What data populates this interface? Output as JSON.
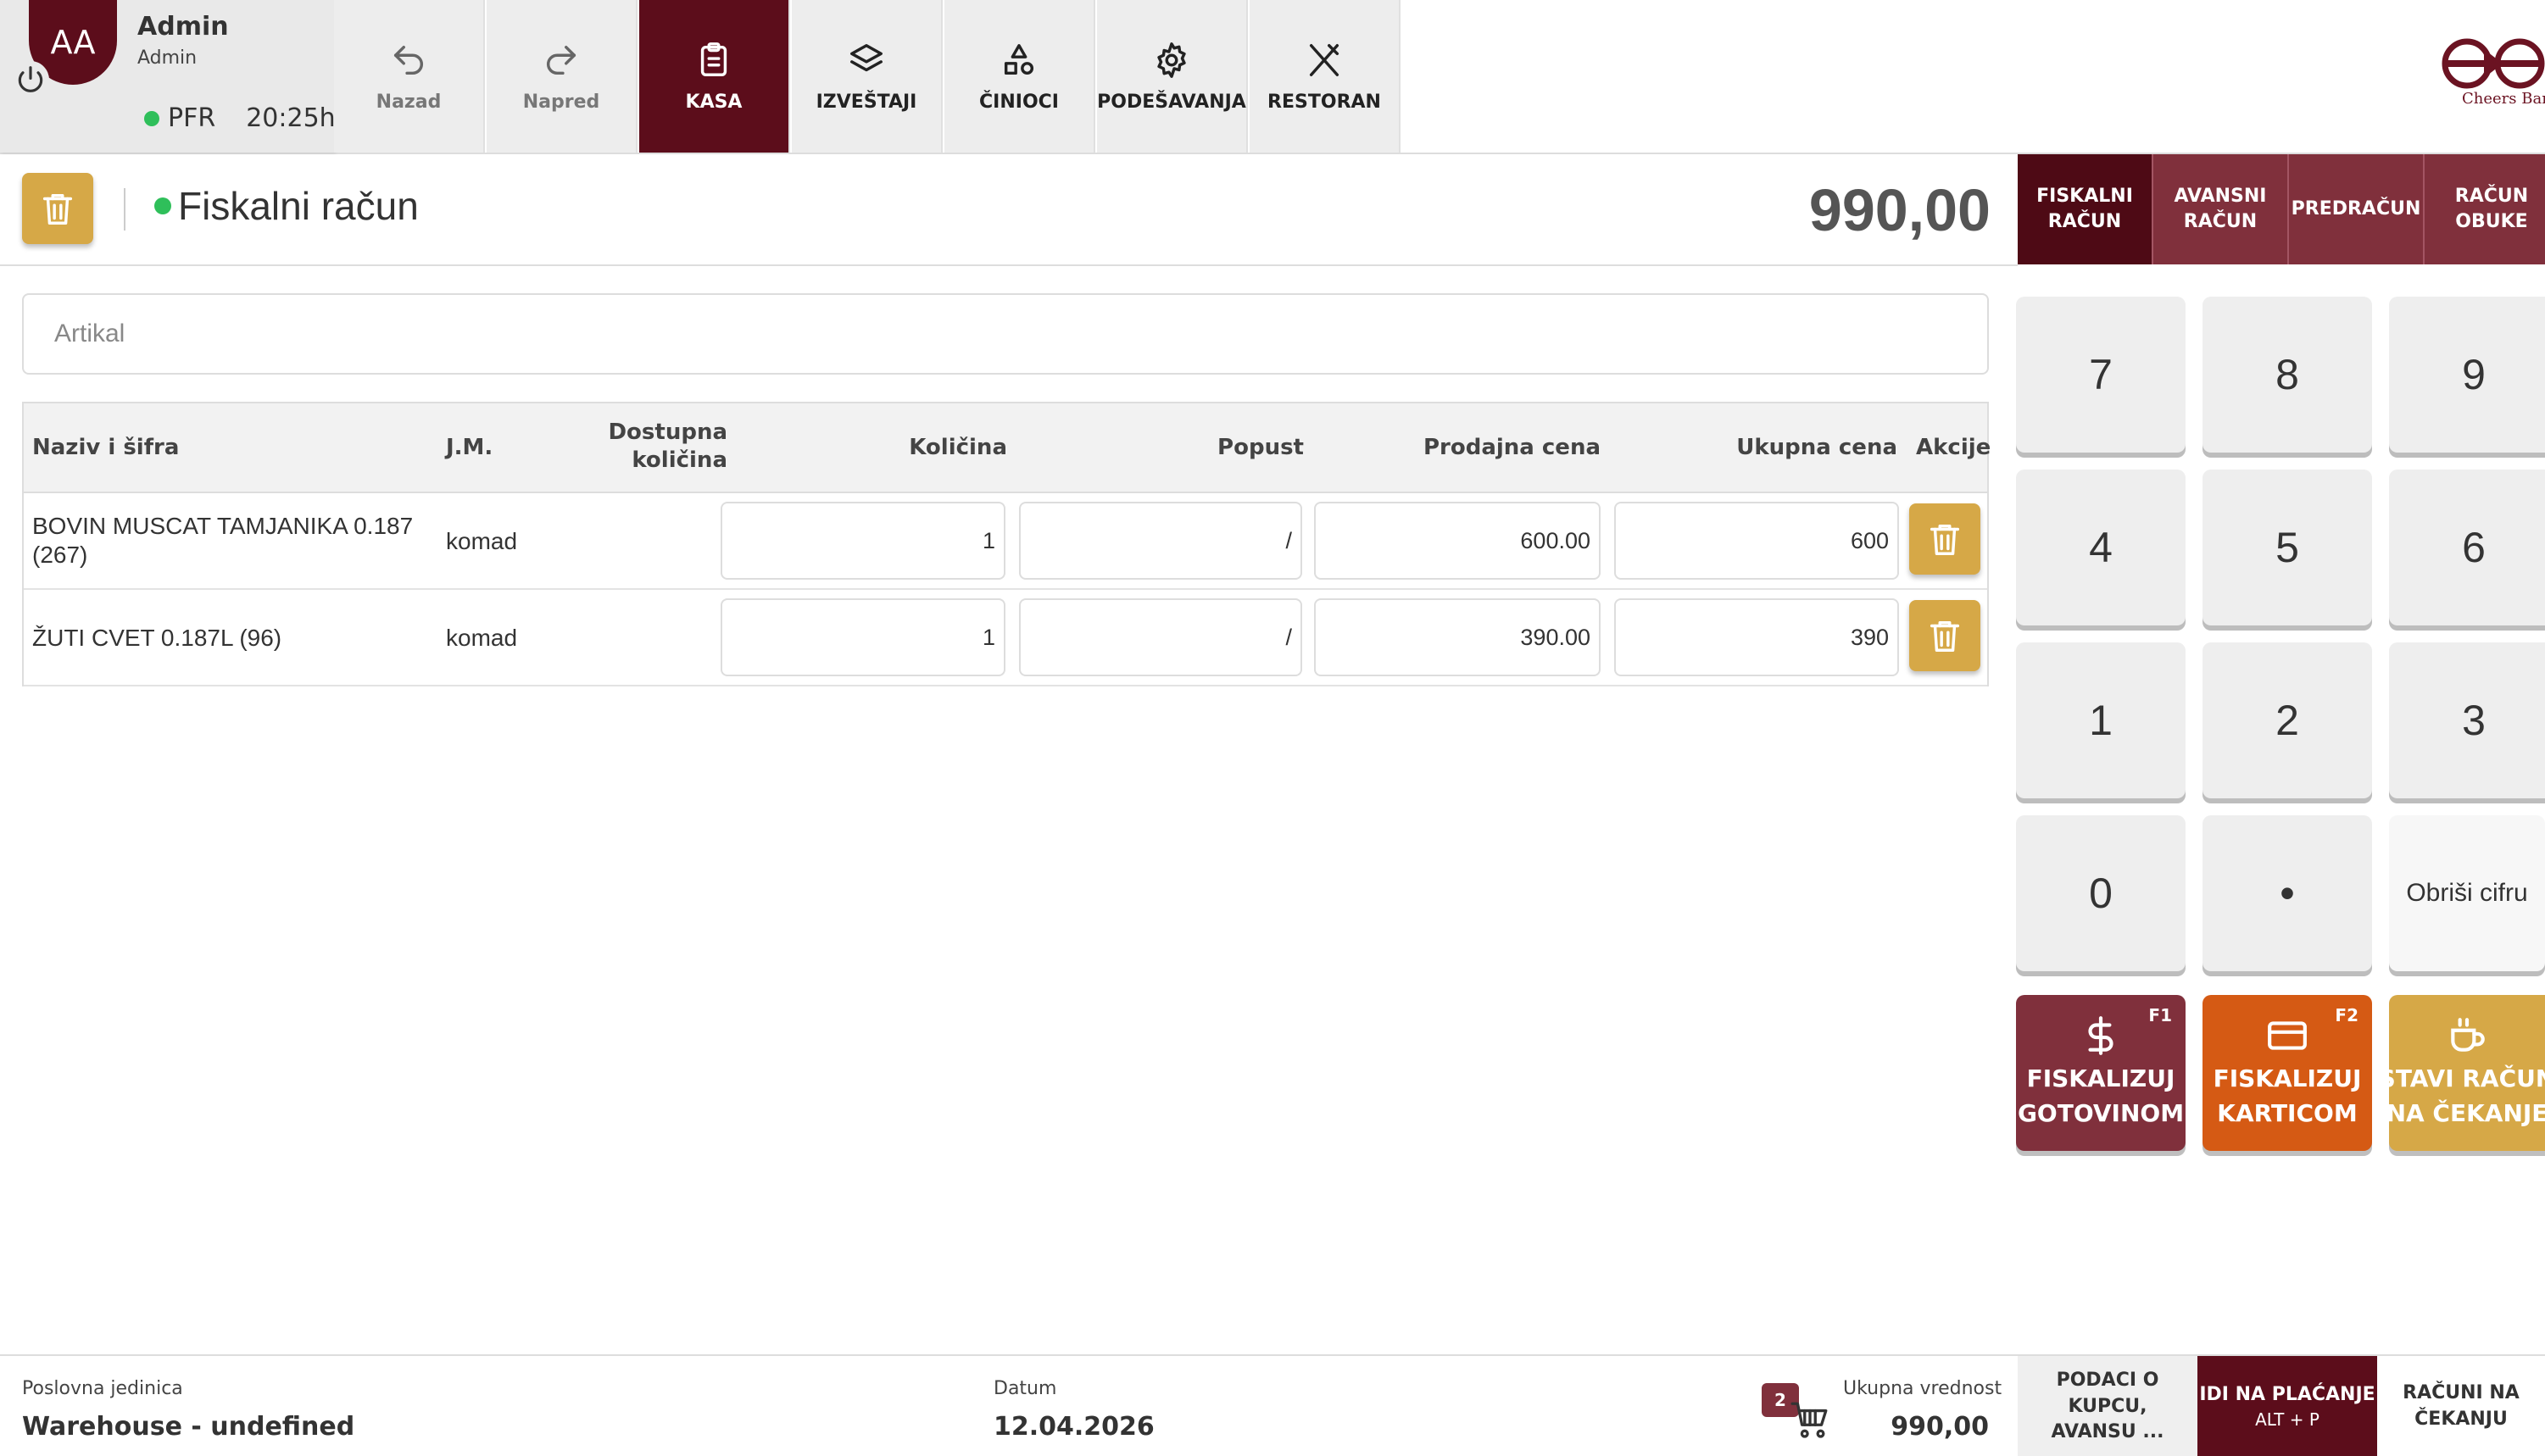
{
  "user": {
    "initials": "AA",
    "name": "Admin",
    "role": "Admin",
    "pfr_label": "PFR",
    "time": "20:25h"
  },
  "nav": [
    {
      "label": "Nazad",
      "icon": "undo-icon"
    },
    {
      "label": "Napred",
      "icon": "redo-icon"
    },
    {
      "label": "KASA",
      "icon": "clipboard-icon"
    },
    {
      "label": "IZVEŠTAJI",
      "icon": "layers-icon"
    },
    {
      "label": "ČINIOCI",
      "icon": "shapes-icon"
    },
    {
      "label": "PODEŠAVANJA",
      "icon": "gear-icon"
    },
    {
      "label": "RESTORAN",
      "icon": "utensils-icon"
    }
  ],
  "brand": {
    "name": "Cheers Bar",
    "color": "#6b1322"
  },
  "receipt": {
    "title": "Fiskalni račun",
    "total": "990,00"
  },
  "doc_tabs": [
    {
      "line1": "FISKALNI",
      "line2": "RAČUN"
    },
    {
      "line1": "AVANSNI",
      "line2": "RAČUN"
    },
    {
      "line1": "PREDRAČUN",
      "line2": ""
    },
    {
      "line1": "RAČUN",
      "line2": "OBUKE"
    }
  ],
  "search": {
    "placeholder": "Artikal",
    "value": ""
  },
  "table": {
    "headers": {
      "name": "Naziv i šifra",
      "unit": "J.M.",
      "available_1": "Dostupna",
      "available_2": "količina",
      "qty": "Količina",
      "discount": "Popust",
      "price": "Prodajna cena",
      "total": "Ukupna cena",
      "actions": "Akcije"
    },
    "rows": [
      {
        "name": "BOVIN MUSCAT TAMJANIKA 0.187 (267)",
        "unit": "komad",
        "available": "/",
        "qty": "1",
        "discount": "/",
        "price": "600.00",
        "total": "600"
      },
      {
        "name": "ŽUTI CVET 0.187L (96)",
        "unit": "komad",
        "available": "/",
        "qty": "1",
        "discount": "/",
        "price": "390.00",
        "total": "390"
      }
    ]
  },
  "keypad": {
    "keys": [
      "7",
      "8",
      "9",
      "4",
      "5",
      "6",
      "1",
      "2",
      "3",
      "0",
      "•",
      "Obriši cifru"
    ],
    "actions": [
      {
        "line1": "FISKALIZUJ",
        "line2": "GOTOVINOM",
        "fkey": "F1",
        "icon": "dollar-icon",
        "color": "#80303c"
      },
      {
        "line1": "FISKALIZUJ",
        "line2": "KARTICOM",
        "fkey": "F2",
        "icon": "credit-card-icon",
        "color": "#d55a14"
      },
      {
        "line1": "STAVI RAČUN",
        "line2": "NA ČEKANJE",
        "fkey": "",
        "icon": "coffee-cup-icon",
        "color": "#d6a847"
      }
    ]
  },
  "footer": {
    "unit_label": "Poslovna jedinica",
    "unit_value": "Warehouse - undefined",
    "date_label": "Datum",
    "date_value": "12.04.2026",
    "cart_count": "2",
    "total_label": "Ukupna vrednost",
    "total_value": "990,00",
    "buttons": [
      {
        "line1": "PODACI O KUPCU,",
        "line2": "AVANSU ..."
      },
      {
        "line1": "IDI NA PLAĆANJE",
        "line2": "ALT + P"
      },
      {
        "line1": "RAČUNI NA",
        "line2": "ČEKANJU"
      }
    ]
  }
}
